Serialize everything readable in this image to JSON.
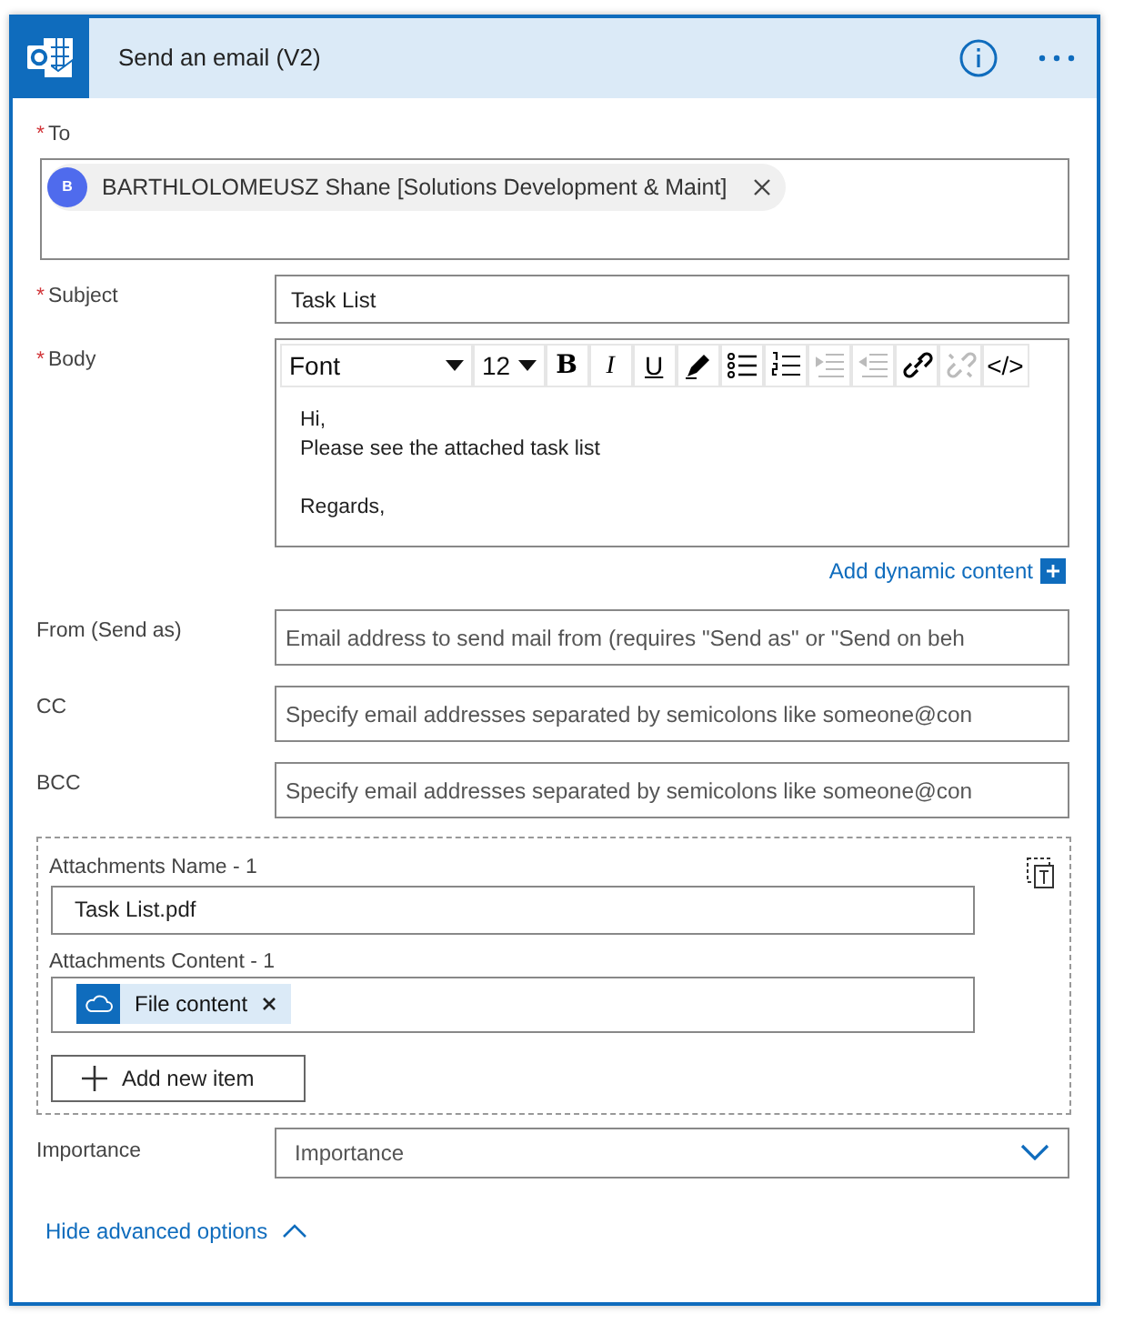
{
  "action": {
    "title": "Send an email (V2)"
  },
  "to": {
    "mark": "*",
    "label": "To",
    "recipients": [
      {
        "initial": "B",
        "name": "BARTHLOLOMEUSZ Shane [Solutions Development & Maint]"
      }
    ]
  },
  "subject": {
    "mark": "*",
    "label": "Subject",
    "value": "Task List"
  },
  "body": {
    "mark": "*",
    "label": "Body",
    "font": "Font",
    "size": "12",
    "tools": [
      {
        "kind": "bold",
        "label": "B",
        "disabled": false
      },
      {
        "kind": "italic",
        "label": "I",
        "disabled": false
      },
      {
        "kind": "underline",
        "label": "U",
        "disabled": false
      },
      {
        "kind": "pen",
        "disabled": false
      },
      {
        "kind": "bullets",
        "disabled": false
      },
      {
        "kind": "numbers",
        "disabled": false
      },
      {
        "kind": "indent",
        "disabled": true
      },
      {
        "kind": "outdent",
        "disabled": true
      },
      {
        "kind": "link",
        "disabled": false
      },
      {
        "kind": "unlink",
        "disabled": true
      },
      {
        "kind": "code",
        "label": "</>",
        "disabled": false
      }
    ],
    "paragraphs": [
      [
        "Hi,",
        "Please see the attached task list"
      ],
      [
        "Regards,"
      ]
    ]
  },
  "dynamic_link": "Add dynamic content",
  "fields": [
    {
      "label": "From (Send as)",
      "placeholder": "Email address to send mail from (requires \"Send as\" or \"Send on beh"
    },
    {
      "label": "CC",
      "placeholder": "Specify email addresses separated by semicolons like someone@con"
    },
    {
      "label": "BCC",
      "placeholder": "Specify email addresses separated by semicolons like someone@con"
    }
  ],
  "attachments": {
    "items": [
      {
        "name_label": "Attachments Name - 1",
        "name_value": "Task List.pdf",
        "content_label": "Attachments Content - 1",
        "tokens": [
          {
            "label": "File content"
          }
        ]
      }
    ],
    "add_button": "Add new item"
  },
  "importance": {
    "label": "Importance",
    "placeholder": "Importance"
  },
  "toggle": "Hide advanced options"
}
